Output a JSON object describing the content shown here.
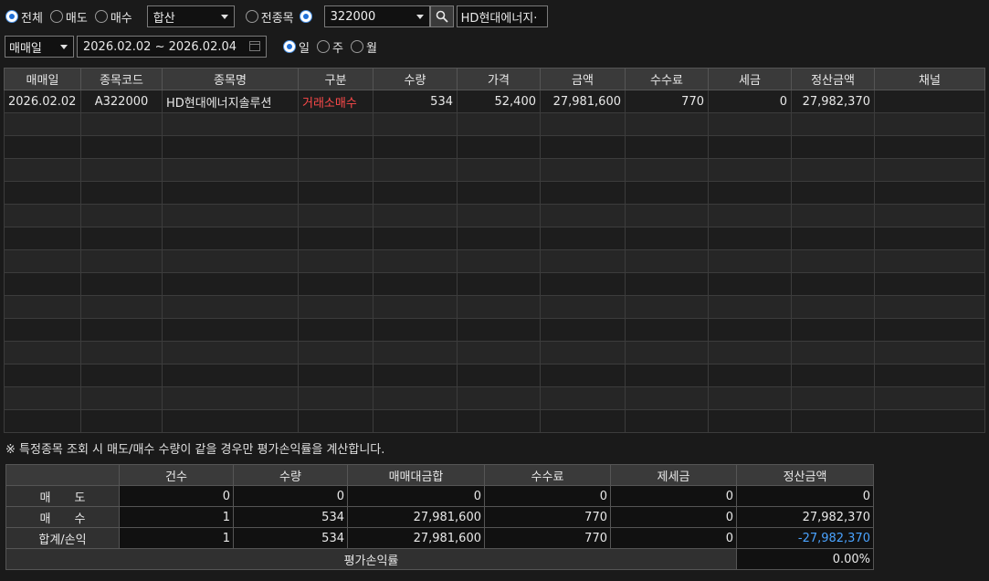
{
  "filters": {
    "trade_type": {
      "all": "전체",
      "sell": "매도",
      "buy": "매수",
      "selected": "all"
    },
    "sum_mode": "합산",
    "stock_scope": {
      "all": "전종목",
      "selected": "single"
    },
    "stock_code": "322000",
    "stock_name": "HD현대에너지·",
    "date_type": "매매일",
    "date_range": "2026.02.02 ~ 2026.02.04",
    "period": {
      "day": "일",
      "week": "주",
      "month": "월",
      "selected": "day"
    }
  },
  "grid": {
    "columns": [
      "매매일",
      "종목코드",
      "종목명",
      "구분",
      "수량",
      "가격",
      "금액",
      "수수료",
      "세금",
      "정산금액",
      "채널"
    ],
    "rows": [
      [
        "2026.02.02",
        "A322000",
        "HD현대에너지솔루션",
        "거래소매수",
        "534",
        "52,400",
        "27,981,600",
        "770",
        "0",
        "27,982,370",
        ""
      ]
    ],
    "total_rows": 15
  },
  "notice": "※ 특정종목 조회 시 매도/매수 수량이 같을 경우만 평가손익률을 계산합니다.",
  "summary": {
    "columns": [
      "",
      "건수",
      "수량",
      "매매대금합",
      "수수료",
      "제세금",
      "정산금액"
    ],
    "rows": [
      {
        "label": "매　　도",
        "values": [
          "0",
          "0",
          "0",
          "0",
          "0",
          "0"
        ]
      },
      {
        "label": "매　　수",
        "values": [
          "1",
          "534",
          "27,981,600",
          "770",
          "0",
          "27,982,370"
        ]
      },
      {
        "label": "합계/손익",
        "values": [
          "1",
          "534",
          "27,981,600",
          "770",
          "0",
          "-27,982,370"
        ]
      }
    ],
    "rate_label": "평가손익률",
    "rate_value": "0.00%"
  },
  "colors": {
    "accent": "#1f6fd6",
    "buy_text": "#ff4a4a",
    "loss_text": "#4aa3ff"
  },
  "icons": {
    "search": "magnifier-icon",
    "calendar": "calendar-icon"
  }
}
